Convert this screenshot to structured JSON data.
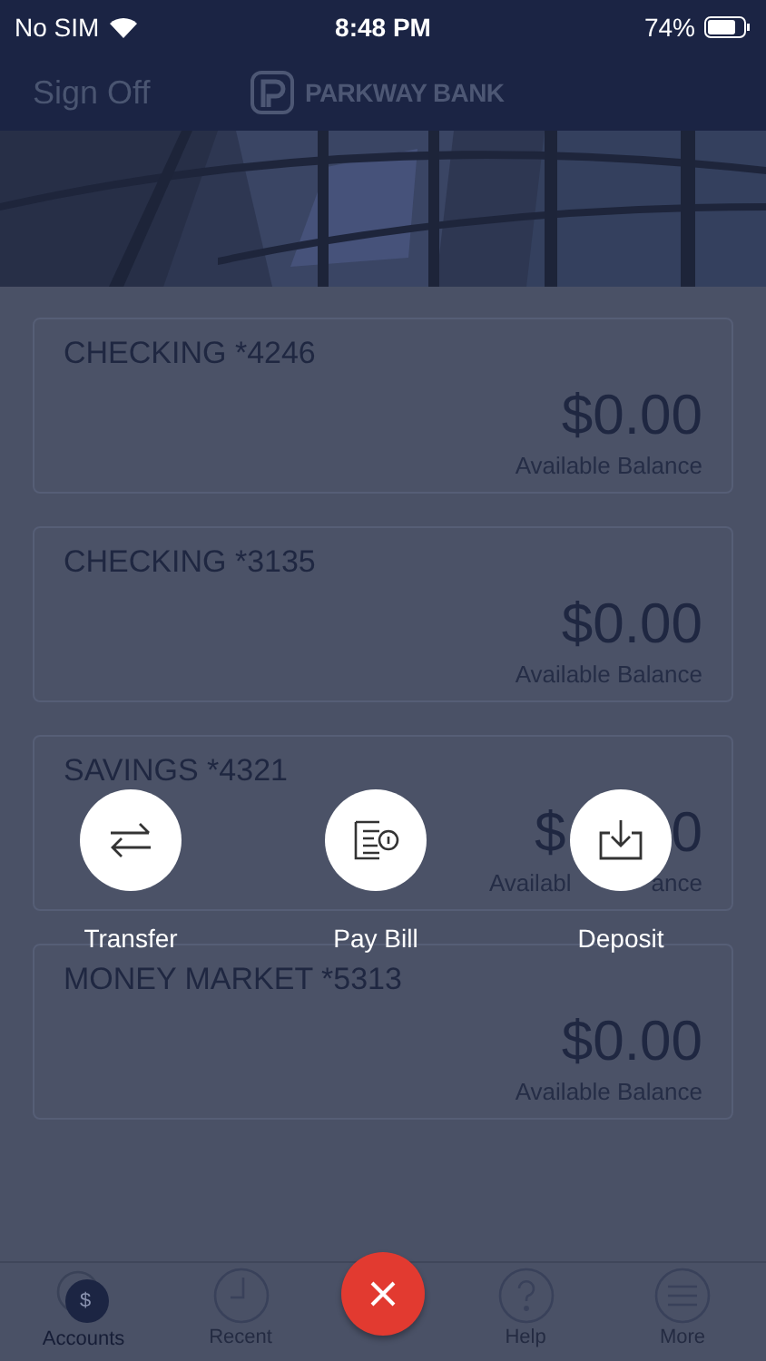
{
  "status_bar": {
    "carrier": "No SIM",
    "time": "8:48 PM",
    "battery": "74%"
  },
  "header": {
    "sign_off": "Sign Off",
    "brand": "PARKWAY BANK"
  },
  "accounts": [
    {
      "name": "CHECKING *4246",
      "balance": "$0.00",
      "balance_label": "Available Balance"
    },
    {
      "name": "CHECKING *3135",
      "balance": "$0.00",
      "balance_label": "Available Balance"
    },
    {
      "name": "SAVINGS *4321",
      "balance": [
        "$",
        "0"
      ],
      "balance_label": [
        "Availabl",
        "ance"
      ]
    },
    {
      "name": "MONEY MARKET *5313",
      "balance": "$0.00",
      "balance_label": "Available Balance"
    }
  ],
  "quick_actions": [
    {
      "label": "Transfer",
      "kind": "transfer"
    },
    {
      "label": "Pay Bill",
      "kind": "bill"
    },
    {
      "label": "Deposit",
      "kind": "deposit"
    }
  ],
  "tab_bar": [
    {
      "label": "Accounts",
      "kind": "accounts",
      "selected": true,
      "badge": "$"
    },
    {
      "label": "Recent",
      "kind": "recent",
      "selected": false
    },
    {
      "label": "Help",
      "kind": "help",
      "selected": false
    },
    {
      "label": "More",
      "kind": "more",
      "selected": false
    }
  ]
}
